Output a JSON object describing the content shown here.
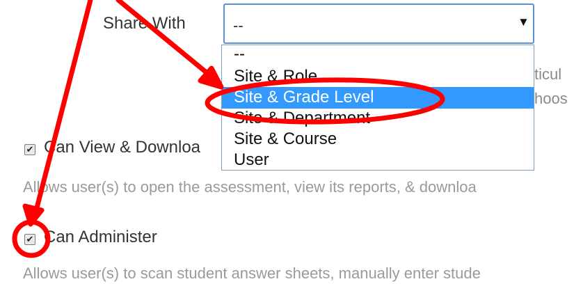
{
  "share": {
    "label": "Share With",
    "selected_value": "--",
    "options": [
      "--",
      "Site & Role",
      "Site & Grade Level",
      "Site & Department",
      "Site & Course",
      "User"
    ],
    "highlighted_option": "Site & Grade Level",
    "behind_text_1": "ticul",
    "behind_text_2": "hoos"
  },
  "permissions": [
    {
      "label": "Can View & Downloa",
      "checked": true,
      "description": "Allows user(s) to open the assessment, view its reports, & downloa"
    },
    {
      "label": "Can Administer",
      "checked": true,
      "description": "Allows user(s) to scan student answer sheets, manually enter stude"
    }
  ],
  "annotation": {
    "color": "#ff0000"
  }
}
